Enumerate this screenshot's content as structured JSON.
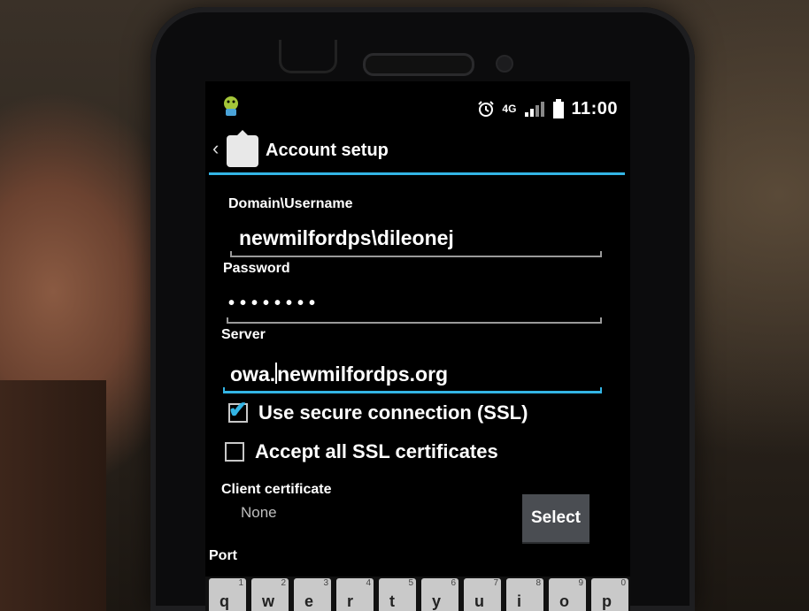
{
  "status_bar": {
    "network": "4G",
    "time": "11:00"
  },
  "action_bar": {
    "title": "Account setup"
  },
  "form": {
    "domain_label": "Domain\\Username",
    "domain_value": "newmilfordps\\dileonej",
    "password_label": "Password",
    "password_value": "••••••••",
    "server_label": "Server",
    "server_value_before_cursor": "owa.",
    "server_value_after_cursor": "newmilfordps.org",
    "ssl_label": "Use secure connection (SSL)",
    "ssl_checked": true,
    "accept_all_label": "Accept all SSL certificates",
    "accept_all_checked": false,
    "client_cert_label": "Client certificate",
    "client_cert_value": "None",
    "select_button": "Select",
    "port_label": "Port"
  },
  "keyboard": {
    "keys": [
      {
        "num": "1",
        "ch": "q"
      },
      {
        "num": "2",
        "ch": "w"
      },
      {
        "num": "3",
        "ch": "e"
      },
      {
        "num": "4",
        "ch": "r"
      },
      {
        "num": "5",
        "ch": "t"
      },
      {
        "num": "6",
        "ch": "y"
      },
      {
        "num": "7",
        "ch": "u"
      },
      {
        "num": "8",
        "ch": "i"
      },
      {
        "num": "9",
        "ch": "o"
      },
      {
        "num": "0",
        "ch": "p"
      }
    ]
  },
  "colors": {
    "accent": "#33b5e5",
    "screen_bg": "#000000",
    "button_bg": "#4a4d52"
  }
}
